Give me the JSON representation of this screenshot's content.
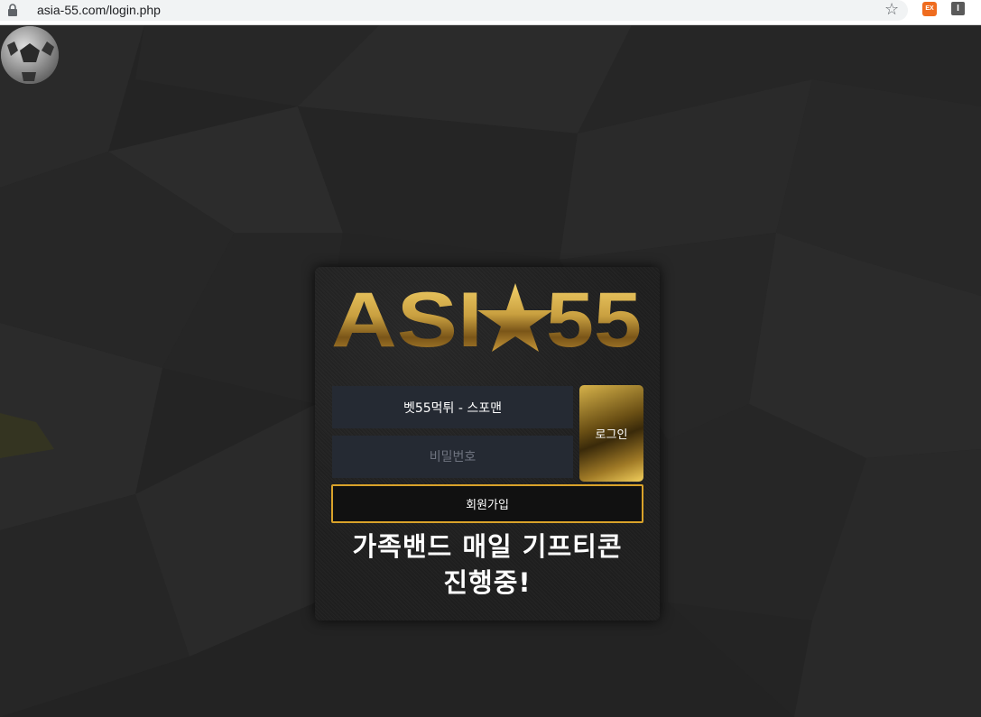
{
  "browser": {
    "url": "asia-55.com/login.php",
    "extension_1_label": "EX",
    "extension_2_label": "I"
  },
  "logo": {
    "text_left": "ASI",
    "text_right": "55",
    "icon": "star-icon",
    "color": "#c9a040"
  },
  "login_form": {
    "username_value": "벳55먹튀 - 스포맨",
    "password_placeholder": "비밀번호",
    "login_button_label": "로그인",
    "join_button_label": "회원가입"
  },
  "promo": {
    "line1": "가족밴드 매일 기프티콘",
    "line2": "진행중!"
  },
  "colors": {
    "accent_gold": "#d9a22a",
    "input_bg": "#252a33",
    "page_bg": "#242424"
  }
}
